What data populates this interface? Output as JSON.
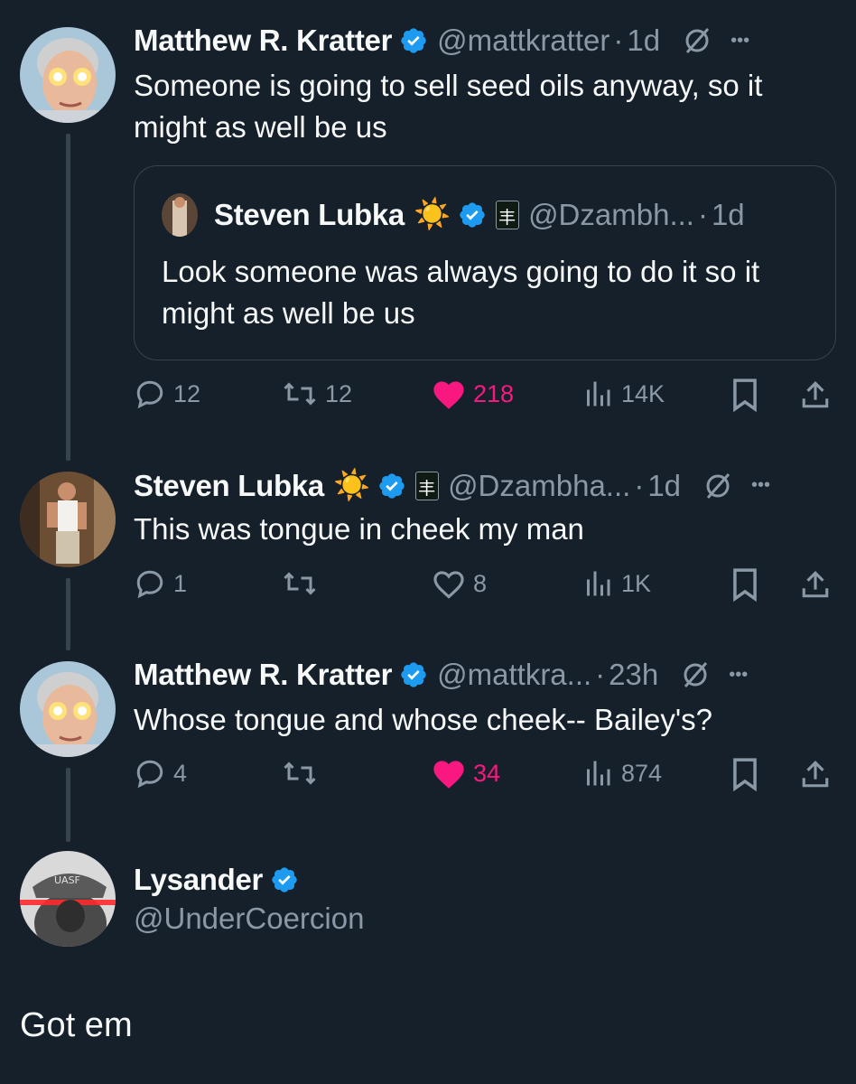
{
  "tweets": [
    {
      "author": "Matthew R. Kratter",
      "handle": "@mattkratter",
      "time": "1d",
      "text": "Someone is going to sell seed oils anyway, so it might as well be us",
      "quote": {
        "author": "Steven Lubka",
        "emoji": "☀️",
        "handle": "@Dzambh...",
        "time": "1d",
        "text": "Look someone was always going to do it so it might as well be us"
      },
      "replies": "12",
      "retweets": "12",
      "likes": "218",
      "views": "14K"
    },
    {
      "author": "Steven Lubka",
      "emoji": "☀️",
      "handle": "@Dzambha...",
      "time": "1d",
      "text": "This was tongue in cheek my man",
      "replies": "1",
      "retweets": "",
      "likes": "8",
      "views": "1K"
    },
    {
      "author": "Matthew R. Kratter",
      "handle": "@mattkra...",
      "time": "23h",
      "text": "Whose tongue and whose cheek-- Bailey's?",
      "replies": "4",
      "retweets": "",
      "likes": "34",
      "views": "874"
    }
  ],
  "reply_author": {
    "name": "Lysander",
    "handle": "@UnderCoercion",
    "avatar_text": "UASF"
  },
  "reply_text": "Got em",
  "flair_text": "丰",
  "separator": "·",
  "more_glyph": "•••",
  "colors": {
    "background": "#15202b",
    "muted": "#8b98a5",
    "like": "#f91880",
    "verified": "#1d9bf0"
  }
}
